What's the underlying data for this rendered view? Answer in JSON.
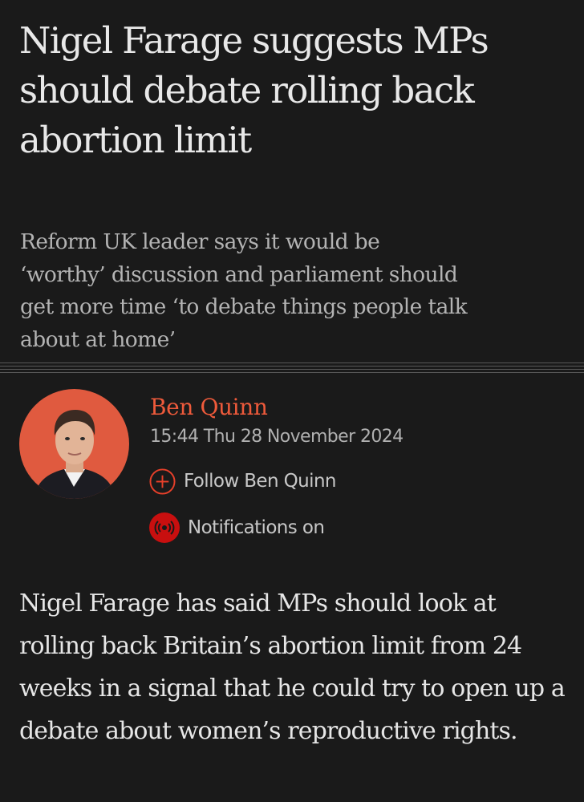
{
  "article": {
    "headline": "Nigel Farage suggests MPs should debate rolling back abortion limit",
    "standfirst": "Reform UK leader says it would be ‘worthy’ discussion and parliament should get more time ‘to debate things people talk about at home’",
    "author": {
      "name": "Ben Quinn",
      "dateline": "15:44 Thu 28 November 2024",
      "avatar_bg": "#e05a3f"
    },
    "follow": {
      "label": "Follow Ben Quinn",
      "icon": "plus-circle-icon",
      "color": "#e8402a"
    },
    "notifications": {
      "label": "Notifications on",
      "icon": "notification-broadcast-icon",
      "color": "#c80f0f"
    },
    "body": "Nigel Farage has said MPs should look at rolling back Britain’s abortion limit from 24 weeks in a signal that he could try to open up a debate about women’s reproductive rights."
  },
  "colors": {
    "background": "#1a1a1a",
    "accent": "#ee5a3b",
    "text": "#e6e6e6",
    "muted": "#b3b3b3"
  }
}
